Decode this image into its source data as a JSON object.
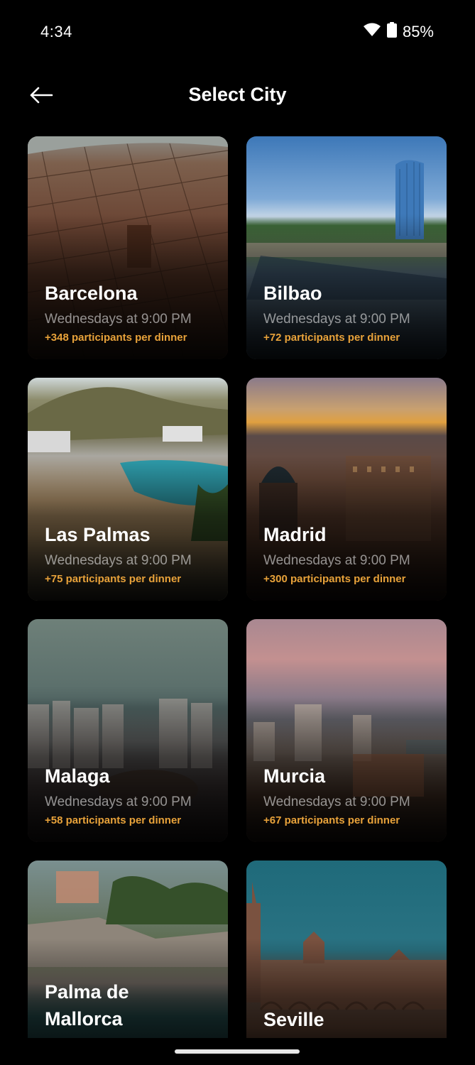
{
  "status": {
    "time": "4:34",
    "battery": "85%"
  },
  "header": {
    "title": "Select City"
  },
  "cities": [
    {
      "name": "Barcelona",
      "schedule": "Wednesdays at 9:00 PM",
      "participants": "+348 participants per dinner"
    },
    {
      "name": "Bilbao",
      "schedule": "Wednesdays at 9:00 PM",
      "participants": "+72 participants per dinner"
    },
    {
      "name": "Las Palmas",
      "schedule": "Wednesdays at 9:00 PM",
      "participants": "+75 participants per dinner"
    },
    {
      "name": "Madrid",
      "schedule": "Wednesdays at 9:00 PM",
      "participants": "+300 participants per dinner"
    },
    {
      "name": "Malaga",
      "schedule": "Wednesdays at 9:00 PM",
      "participants": "+58 participants per dinner"
    },
    {
      "name": "Murcia",
      "schedule": "Wednesdays at 9:00 PM",
      "participants": "+67 participants per dinner"
    },
    {
      "name_line1": "Palma de",
      "name_line2": "Mallorca"
    },
    {
      "name": "Seville"
    }
  ],
  "colors": {
    "accent": "#e8a23a",
    "background": "#000000"
  }
}
